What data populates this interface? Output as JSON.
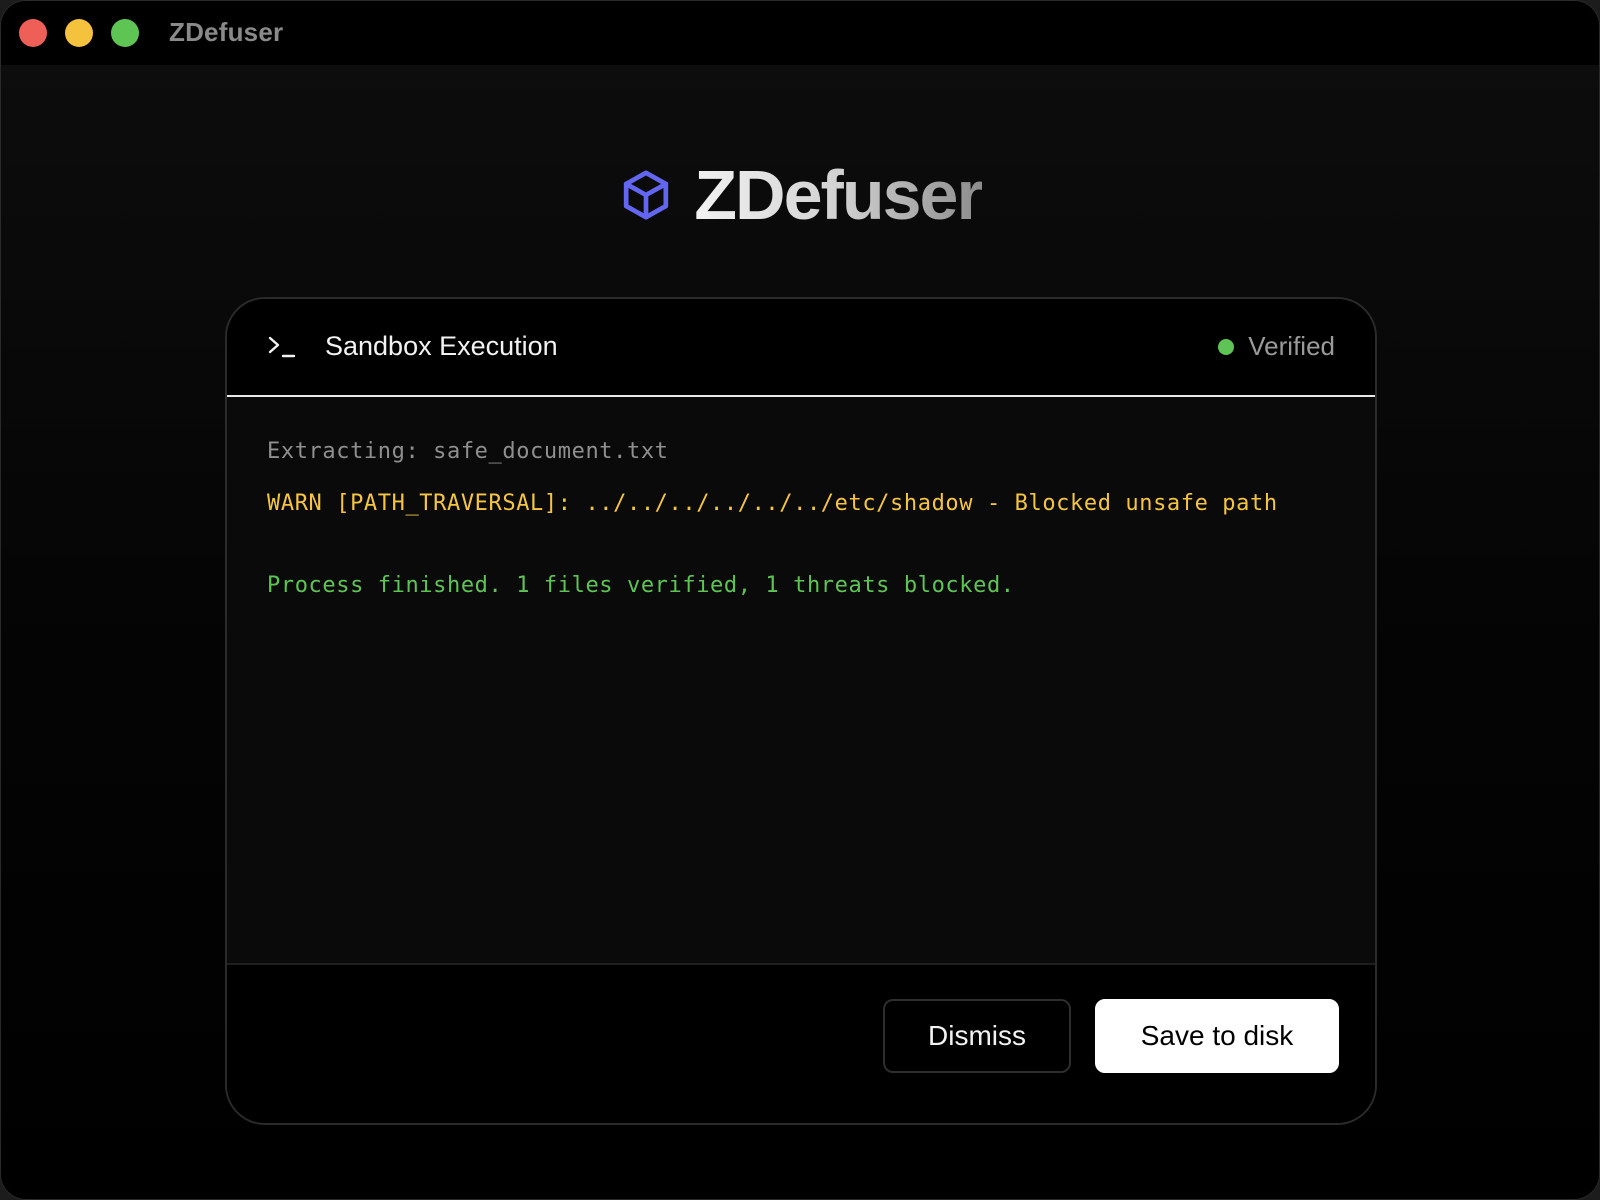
{
  "window": {
    "title": "ZDefuser"
  },
  "brand": {
    "name": "ZDefuser",
    "icon": "cube-icon",
    "icon_color": "#6366f1"
  },
  "card": {
    "title": "Sandbox Execution",
    "header_icon": "terminal-prompt-icon",
    "status": {
      "label": "Verified",
      "color": "#5ec454"
    },
    "log": [
      {
        "level": "info",
        "text": "Extracting: safe_document.txt",
        "color": "#8f8f8f"
      },
      {
        "level": "warn",
        "text": "WARN [PATH_TRAVERSAL]: ../../../../../../etc/shadow - Blocked unsafe path",
        "color": "#f5c542"
      },
      {
        "level": "success",
        "text": "Process finished. 1 files verified, 1 threats blocked.",
        "color": "#5ec454"
      }
    ],
    "actions": {
      "dismiss_label": "Dismiss",
      "save_label": "Save to disk"
    }
  }
}
